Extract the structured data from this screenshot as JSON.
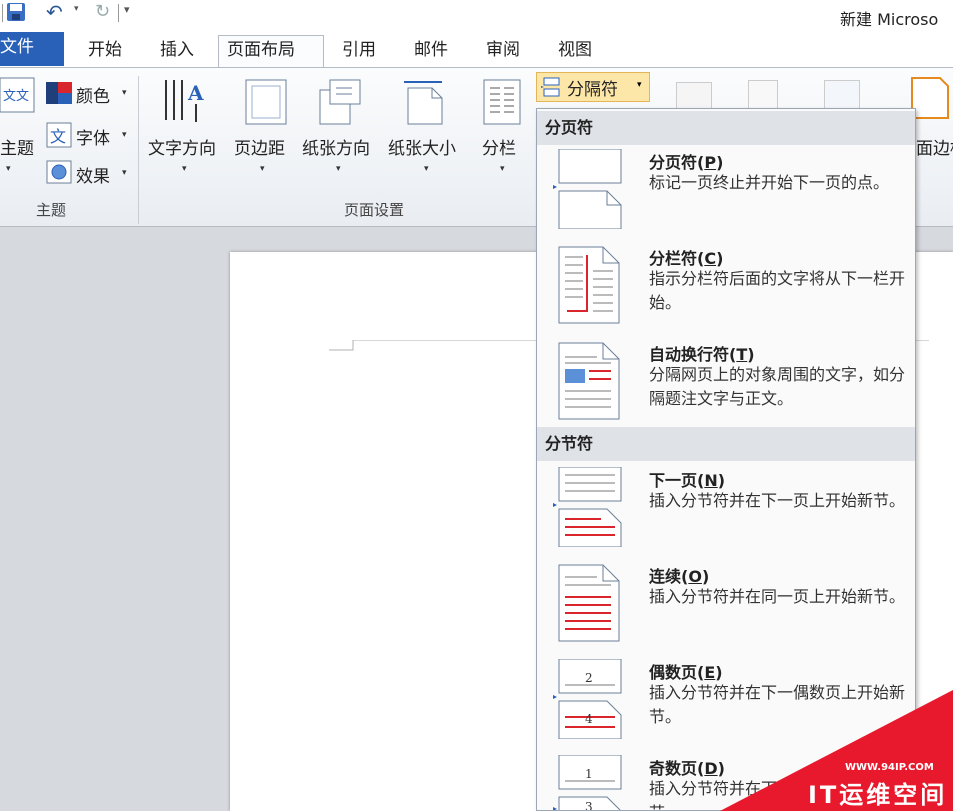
{
  "titlebar": {
    "document_title": "新建 Microso",
    "customize_arrow": "▾"
  },
  "tabs": [
    {
      "label": "文件",
      "active": false
    },
    {
      "label": "开始",
      "active": false
    },
    {
      "label": "插入",
      "active": false
    },
    {
      "label": "页面布局",
      "active": true
    },
    {
      "label": "引用",
      "active": false
    },
    {
      "label": "邮件",
      "active": false
    },
    {
      "label": "审阅",
      "active": false
    },
    {
      "label": "视图",
      "active": false
    }
  ],
  "ribbon": {
    "theme_group": {
      "label": "主题",
      "themes_button": "主题",
      "colors_button": "颜色",
      "fonts_button": "字体",
      "effects_button": "效果"
    },
    "page_setup_group": {
      "label": "页面设置",
      "text_direction": "文字方向",
      "margins": "页边距",
      "orientation": "纸张方向",
      "size": "纸张大小",
      "columns": "分栏",
      "breaks": "分隔符"
    },
    "page_borders_partial": "面边框"
  },
  "breaks_menu": {
    "page_breaks_header": "分页符",
    "section_breaks_header": "分节符",
    "items": [
      {
        "title": "分页符(",
        "key": "P",
        "close": ")",
        "desc": "标记一页终止并开始下一页的点。"
      },
      {
        "title": "分栏符(",
        "key": "C",
        "close": ")",
        "desc": "指示分栏符后面的文字将从下一栏开始。"
      },
      {
        "title": "自动换行符(",
        "key": "T",
        "close": ")",
        "desc": "分隔网页上的对象周围的文字，如分隔题注文字与正文。"
      },
      {
        "title": "下一页(",
        "key": "N",
        "close": ")",
        "desc": "插入分节符并在下一页上开始新节。"
      },
      {
        "title": "连续(",
        "key": "O",
        "close": ")",
        "desc": "插入分节符并在同一页上开始新节。"
      },
      {
        "title": "偶数页(",
        "key": "E",
        "close": ")",
        "desc": "插入分节符并在下一偶数页上开始新节。"
      },
      {
        "title": "奇数页(",
        "key": "D",
        "close": ")",
        "desc": "插入分节符并在下一奇数页上开始新节。"
      }
    ],
    "even_icon_numbers": [
      "2",
      "4"
    ],
    "odd_icon_numbers": [
      "1",
      "3"
    ]
  },
  "watermark": {
    "url": "WWW.94IP.COM",
    "text": "IT运维空间"
  },
  "colors": {
    "file_tab": "#2a61b8",
    "ribbon_bg": "#eef1f5",
    "highlight": "#fde7a8",
    "watermark": "#e8192c"
  }
}
